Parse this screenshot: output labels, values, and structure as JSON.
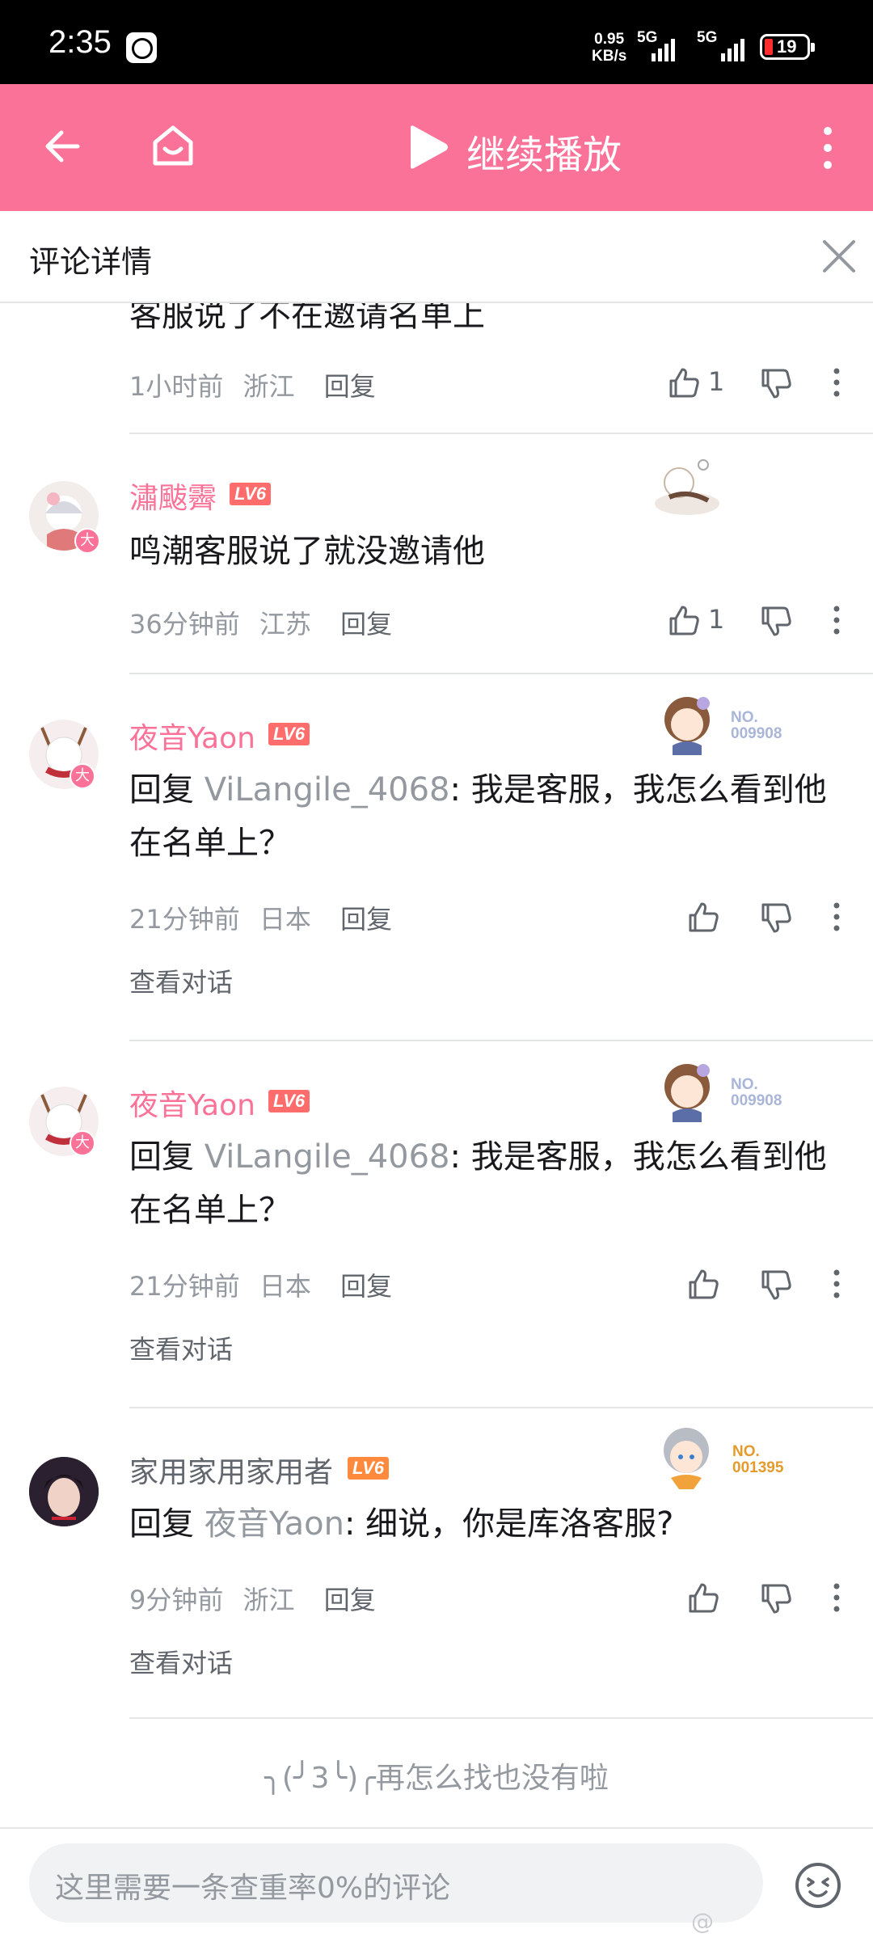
{
  "status_bar": {
    "time": "2:35",
    "speed_value": "0.95",
    "speed_unit": "KB/s",
    "net1": "5G",
    "net2": "5G",
    "battery": "19"
  },
  "top_bar": {
    "continue_label": "继续播放",
    "accent_color": "#fb7299"
  },
  "header": {
    "title": "评论详情"
  },
  "comments": [
    {
      "content": "客服说了不在邀请名单上",
      "time": "1小时前",
      "location": "浙江",
      "reply_label": "回复",
      "likes": "1"
    },
    {
      "username": "潚颰霽",
      "level": "LV6",
      "content": "鸣潮客服说了就没邀请他",
      "time": "36分钟前",
      "location": "江苏",
      "reply_label": "回复",
      "likes": "1"
    },
    {
      "username": "夜音Yaon",
      "level": "LV6",
      "deco_no": "NO.",
      "deco_num": "009908",
      "reply_prefix": "回复",
      "reply_target": "ViLangile_4068",
      "content": ":  我是客服，我怎么看到他在名单上？",
      "time": "21分钟前",
      "location": "日本",
      "reply_label": "回复",
      "see_conversation": "查看对话"
    },
    {
      "username": "夜音Yaon",
      "level": "LV6",
      "deco_no": "NO.",
      "deco_num": "009908",
      "reply_prefix": "回复",
      "reply_target": "ViLangile_4068",
      "content": ":  我是客服，我怎么看到他在名单上？",
      "time": "21分钟前",
      "location": "日本",
      "reply_label": "回复",
      "see_conversation": "查看对话"
    },
    {
      "username": "家用家用家用者",
      "level": "LV6",
      "deco_no": "NO.",
      "deco_num": "001395",
      "reply_prefix": "回复",
      "reply_target": "夜音Yaon",
      "content": ": 细说，你是库洛客服?",
      "time": "9分钟前",
      "location": "浙江",
      "reply_label": "回复",
      "see_conversation": "查看对话"
    }
  ],
  "end_message": "╮(╯3╰)╭再怎么找也没有啦",
  "bottom_bar": {
    "input_placeholder": "这里需要一条查重率0%的评论",
    "watermark": "@"
  },
  "icons": {
    "back": "arrow-left-icon",
    "home": "home-icon",
    "play": "play-icon",
    "more": "more-vertical-icon",
    "close": "close-icon",
    "like": "thumbs-up-icon",
    "dislike": "thumbs-down-icon",
    "emoji": "emoji-icon"
  }
}
